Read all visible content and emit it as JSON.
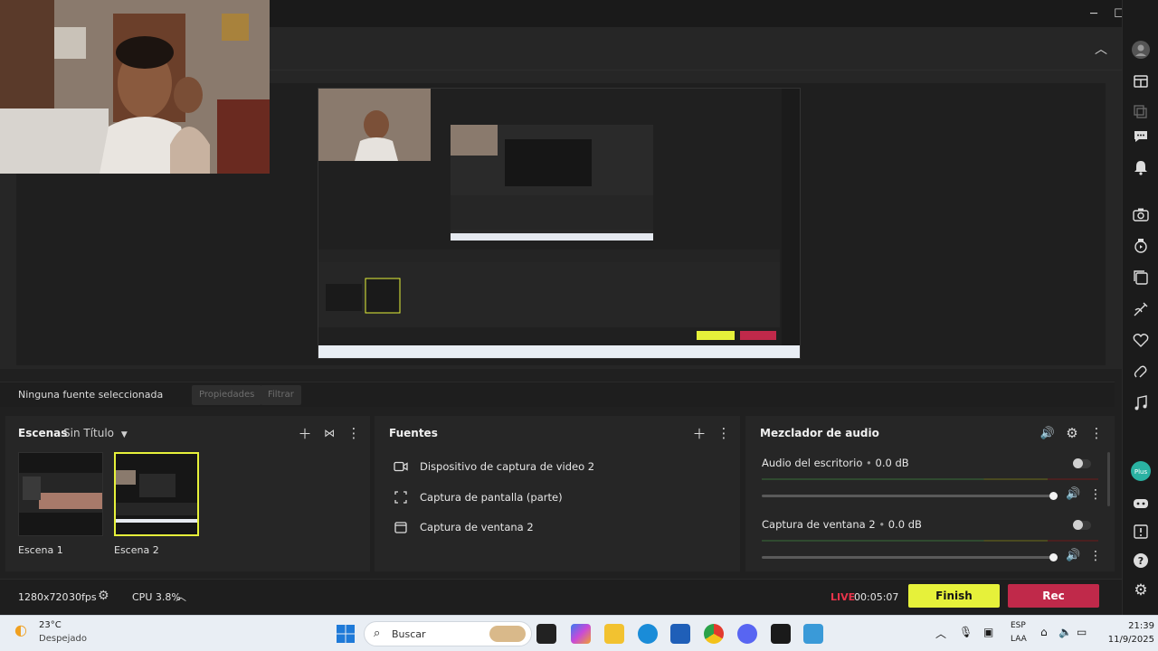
{
  "preview": {
    "nested_source_label": "Ninguna fuente seleccionada"
  },
  "source_bar": {
    "status": "Ninguna fuente seleccionada",
    "properties": "Propiedades",
    "filter": "Filtrar"
  },
  "scenes": {
    "title": "Escenas",
    "collection": "Sin Título",
    "items": [
      {
        "label": "Escena 1",
        "selected": false
      },
      {
        "label": "Escena 2",
        "selected": true
      }
    ]
  },
  "sources": {
    "title": "Fuentes",
    "items": [
      {
        "label": "Dispositivo de captura de video 2",
        "icon": "camera-icon"
      },
      {
        "label": "Captura de pantalla (parte)",
        "icon": "region-capture-icon"
      },
      {
        "label": "Captura de ventana 2",
        "icon": "window-icon"
      }
    ]
  },
  "mixer": {
    "title": "Mezclador de audio",
    "channels": [
      {
        "name": "Audio del escritorio",
        "level": "0.0 dB",
        "volume": 1.0
      },
      {
        "name": "Captura de ventana 2",
        "level": "0.0 dB",
        "volume": 1.0
      }
    ]
  },
  "status": {
    "resolution": "1280x720",
    "fps": "30fps",
    "cpu": "CPU 3.8%",
    "live_label": "LIVE",
    "live_time": "00:05:07",
    "finish": "Finish",
    "rec": "Rec"
  },
  "colors": {
    "accent_yellow": "#e6f13a",
    "rec_red": "#c0294a",
    "live_red": "#e8344a"
  },
  "taskbar": {
    "weather_temp": "23°C",
    "weather_desc": "Despejado",
    "search_placeholder": "Buscar",
    "lang_top": "ESP",
    "lang_bottom": "LAA",
    "time": "21:39",
    "date": "11/9/2025"
  }
}
